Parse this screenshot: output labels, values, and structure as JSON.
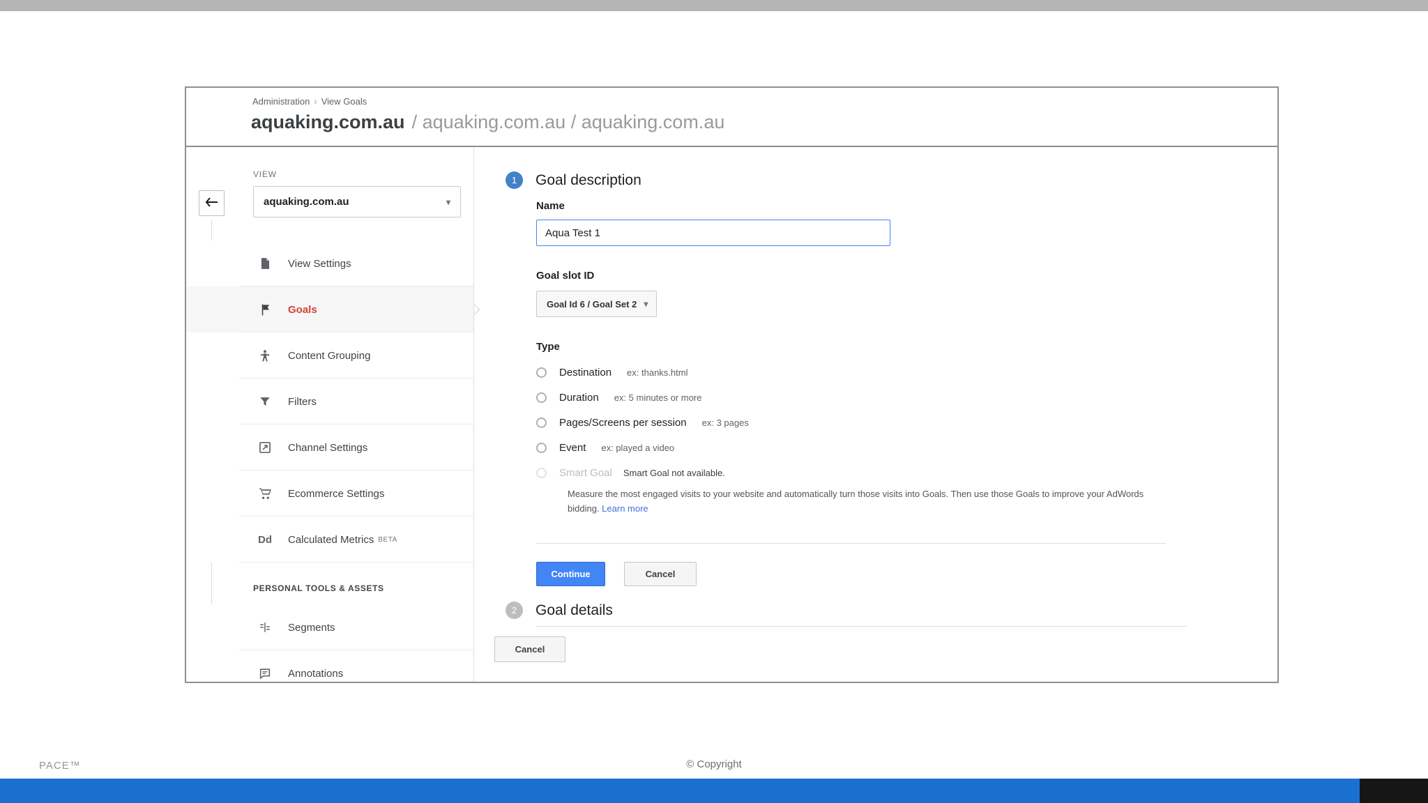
{
  "page": {
    "footer": {
      "left_text": "PACE™",
      "center_text": "© Copyright"
    }
  },
  "header": {
    "breadcrumb": {
      "section": "Administration",
      "separator": "›",
      "page": "View Goals"
    },
    "title_primary": "aquaking.com.au",
    "title_secondary": "/ aquaking.com.au / aquaking.com.au"
  },
  "sidebar": {
    "view_label": "VIEW",
    "view_selector_value": "aquaking.com.au",
    "items": [
      {
        "label": "View Settings",
        "icon": "file-icon"
      },
      {
        "label": "Goals",
        "icon": "flag-icon",
        "selected": true
      },
      {
        "label": "Content Grouping",
        "icon": "person-icon"
      },
      {
        "label": "Filters",
        "icon": "funnel-icon"
      },
      {
        "label": "Channel Settings",
        "icon": "channel-icon"
      },
      {
        "label": "Ecommerce Settings",
        "icon": "cart-icon"
      },
      {
        "label": "Calculated Metrics",
        "icon": "dd-icon",
        "badge": "BETA"
      }
    ],
    "section_heading": "PERSONAL TOOLS & ASSETS",
    "personal_items": [
      {
        "label": "Segments",
        "icon": "segments-icon"
      },
      {
        "label": "Annotations",
        "icon": "annotation-icon"
      }
    ]
  },
  "wizard": {
    "step1": {
      "number": "1",
      "title": "Goal description",
      "name_label": "Name",
      "name_value": "Aqua Test 1",
      "slot_label": "Goal slot ID",
      "slot_value": "Goal Id 6 / Goal Set 2",
      "type_label": "Type",
      "options": [
        {
          "label": "Destination",
          "hint": "ex: thanks.html"
        },
        {
          "label": "Duration",
          "hint": "ex: 5 minutes or more"
        },
        {
          "label": "Pages/Screens per session",
          "hint": "ex: 3 pages"
        },
        {
          "label": "Event",
          "hint": "ex: played a video"
        }
      ],
      "smart_goal": {
        "label": "Smart Goal",
        "status": "Smart Goal not available.",
        "description": "Measure the most engaged visits to your website and automatically turn those visits into Goals. Then use those Goals to improve your AdWords bidding.",
        "link": "Learn more"
      },
      "continue_label": "Continue",
      "cancel_label": "Cancel"
    },
    "step2": {
      "number": "2",
      "title": "Goal details"
    },
    "outer_cancel_label": "Cancel"
  },
  "colors": {
    "accent_blue": "#4285f4",
    "selected_item_red": "#d04437",
    "link_blue": "#4272db",
    "bottom_bar_blue": "#1a70cf",
    "top_bar_gray": "#b5b5b5"
  }
}
